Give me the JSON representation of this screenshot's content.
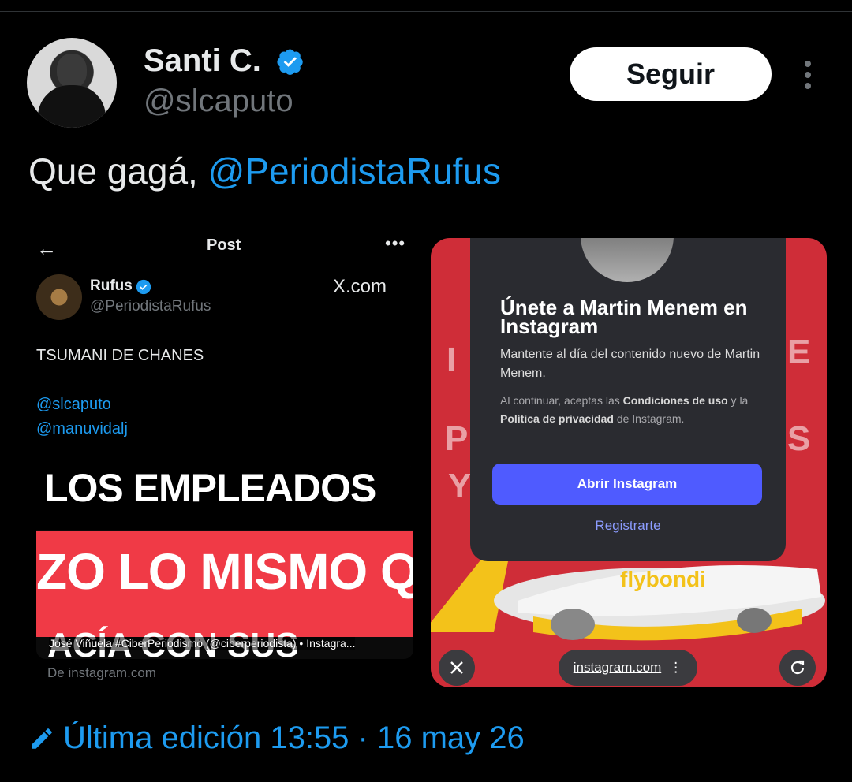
{
  "author": {
    "name": "Santi C.",
    "handle": "@slcaputo",
    "verified": true,
    "follow_label": "Seguir"
  },
  "tweet": {
    "text_prefix": "Que gagá, ",
    "mention": "@PeriodistaRufus"
  },
  "quoted_post": {
    "header_title": "Post",
    "author_name": "Rufus",
    "author_handle": "@PeriodistaRufus",
    "source_label": "X.com",
    "text": "TSUMANI DE CHANES",
    "mentions": [
      "@slcaputo",
      "@manuvidalj"
    ],
    "image": {
      "line1": "LOS EMPLEADOS",
      "line2": "ZO LO MISMO Q",
      "line3": "ACÍA CON SUS",
      "caption": "José Viñuela #CiberPeriodismo (@ciberperiodista) • Instagra..."
    },
    "from_label": "De instagram.com"
  },
  "instagram_dialog": {
    "title": "Únete a Martin Menem en Instagram",
    "subtitle": "Mantente al día del contenido nuevo de Martin Menem.",
    "legal_prefix": "Al continuar, aceptas las ",
    "legal_terms": "Condiciones de uso",
    "legal_mid": " y la ",
    "legal_privacy": "Política de privacidad",
    "legal_suffix": " de Instagram.",
    "open_button": "Abrir Instagram",
    "register_link": "Registrarte",
    "url": "instagram.com"
  },
  "footer": {
    "edited_label": "Última edición 13:55 · 16 may 26"
  },
  "colors": {
    "accent": "#1d9bf0",
    "background": "#000000",
    "instagram_button": "#4f5bff",
    "red_banner": "#f03a46"
  }
}
